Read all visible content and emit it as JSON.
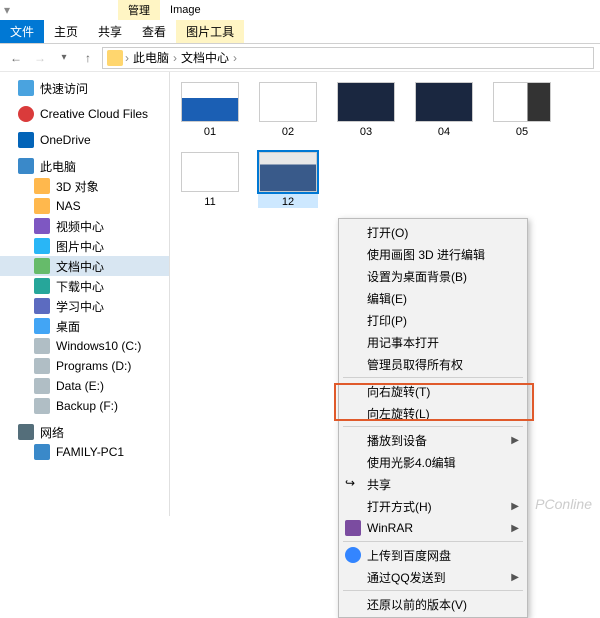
{
  "window": {
    "manage": "管理",
    "title": "Image",
    "tools": "图片工具"
  },
  "tabs": {
    "file": "文件",
    "home": "主页",
    "share": "共享",
    "view": "查看"
  },
  "path": {
    "root": "此电脑",
    "folder": "文档中心"
  },
  "sidebar": {
    "quick": "快速访问",
    "ccf": "Creative Cloud Files",
    "onedrive": "OneDrive",
    "pc": "此电脑",
    "items": [
      "3D 对象",
      "NAS",
      "视频中心",
      "图片中心",
      "文档中心",
      "下载中心",
      "学习中心",
      "桌面",
      "Windows10 (C:)",
      "Programs (D:)",
      "Data (E:)",
      "Backup (F:)"
    ],
    "network": "网络",
    "netitems": [
      "FAMILY-PC1"
    ]
  },
  "thumbs": [
    "01",
    "02",
    "03",
    "04",
    "05",
    "11",
    "12"
  ],
  "ctx": {
    "open": "打开(O)",
    "paint3d": "使用画图 3D 进行编辑",
    "wallpaper": "设置为桌面背景(B)",
    "edit": "编辑(E)",
    "print": "打印(P)",
    "notepad": "用记事本打开",
    "admin": "管理员取得所有权",
    "rotr": "向右旋转(T)",
    "rotl": "向左旋转(L)",
    "cast": "播放到设备",
    "luminar": "使用光影4.0编辑",
    "share": "共享",
    "openwith": "打开方式(H)",
    "winrar": "WinRAR",
    "baidu": "上传到百度网盘",
    "qq": "通过QQ发送到",
    "restore": "还原以前的版本(V)"
  },
  "watermark": "PConline"
}
